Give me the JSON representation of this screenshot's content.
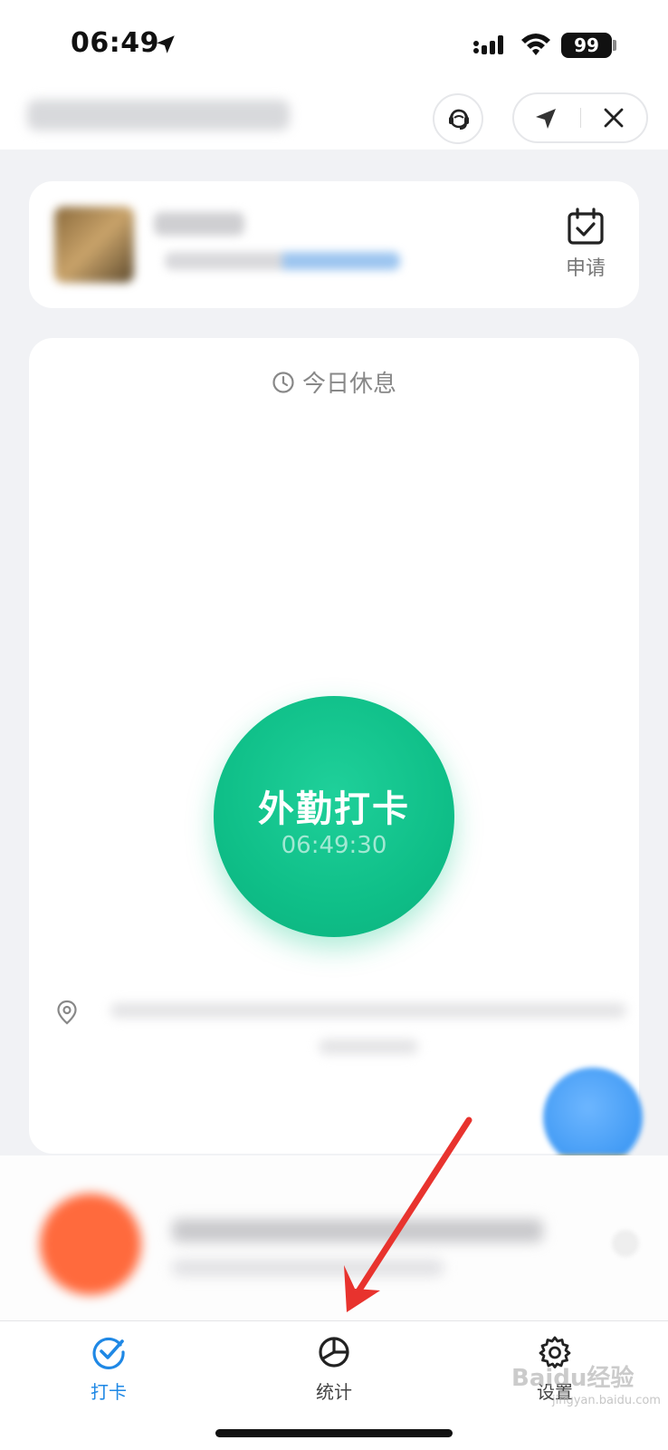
{
  "status_bar": {
    "time": "06:49",
    "battery": "99"
  },
  "header": {
    "support_icon": "headset-icon",
    "nav_icon": "navigation-arrow-icon",
    "close_icon": "close-icon"
  },
  "profile": {
    "apply_label": "申请",
    "apply_icon": "calendar-check-icon"
  },
  "attendance": {
    "status_text": "今日休息",
    "status_icon": "clock-icon",
    "clock_button_label": "外勤打卡",
    "clock_button_time": "06:49:30",
    "location_icon": "location-pin-icon"
  },
  "tabbar": {
    "tabs": [
      {
        "label": "打卡",
        "icon": "check-tab-icon",
        "active": true
      },
      {
        "label": "统计",
        "icon": "pie-chart-icon",
        "active": false
      },
      {
        "label": "设置",
        "icon": "gear-icon",
        "active": false
      }
    ]
  },
  "colors": {
    "accent_green": "#10c38c",
    "tab_active_blue": "#1f88e5",
    "annotation_red": "#e8332e"
  },
  "watermark": {
    "brand": "Baidu经验",
    "url": "jingyan.baidu.com"
  }
}
